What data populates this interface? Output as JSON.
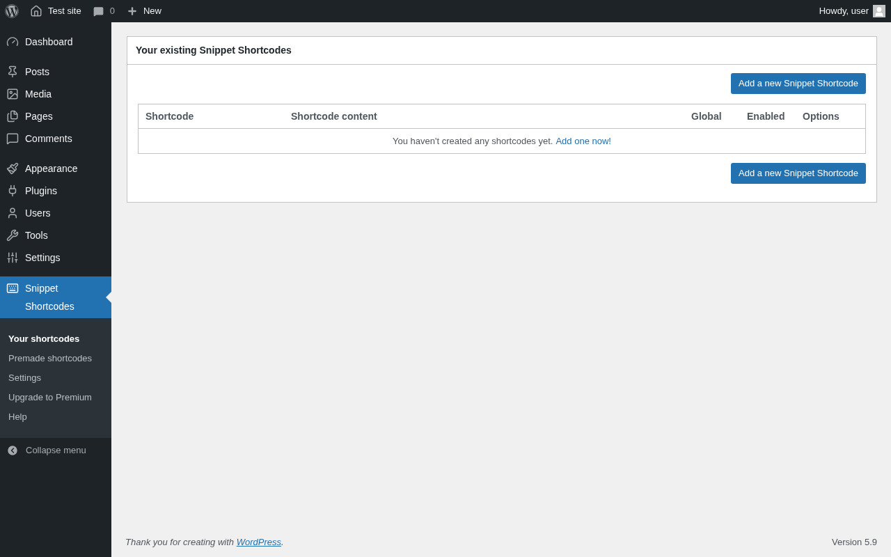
{
  "admin_bar": {
    "site": "Test site",
    "comments_count": "0",
    "new_label": "New",
    "greeting": "Howdy, user"
  },
  "menu_groups": [
    [
      {
        "label": "Dashboard",
        "selected": false
      }
    ],
    [
      {
        "label": "Posts",
        "selected": false
      },
      {
        "label": "Media",
        "selected": false
      },
      {
        "label": "Pages",
        "selected": false
      },
      {
        "label": "Comments",
        "selected": false
      }
    ],
    [
      {
        "label": "Appearance",
        "selected": false
      },
      {
        "label": "Plugins",
        "selected": false
      },
      {
        "label": "Users",
        "selected": false
      },
      {
        "label": "Tools",
        "selected": false
      },
      {
        "label": "Settings",
        "selected": false
      }
    ],
    [
      {
        "label": "Snippet Shortcodes",
        "selected": true
      }
    ]
  ],
  "submenu": [
    {
      "label": "Your shortcodes",
      "selected": true
    },
    {
      "label": "Premade shortcodes",
      "selected": false
    },
    {
      "label": "Settings",
      "selected": false
    },
    {
      "label": "Upgrade to Premium",
      "selected": false
    },
    {
      "label": "Help",
      "selected": false
    }
  ],
  "collapse_label": "Collapse menu",
  "panel": {
    "title": "Your existing Snippet Shortcodes",
    "add_button_top": "Add a new Snippet Shortcode",
    "add_button_bottom": "Add a new Snippet Shortcode",
    "table": {
      "columns": [
        "Shortcode",
        "Shortcode content",
        "Global",
        "Enabled",
        "Options"
      ],
      "empty_message": "You haven't created any shortcodes yet.",
      "empty_link": "Add one now!"
    }
  },
  "footer": {
    "thanks": "Thank you for creating with",
    "link": "WordPress",
    "after": ".",
    "version": "Version 5.9"
  }
}
